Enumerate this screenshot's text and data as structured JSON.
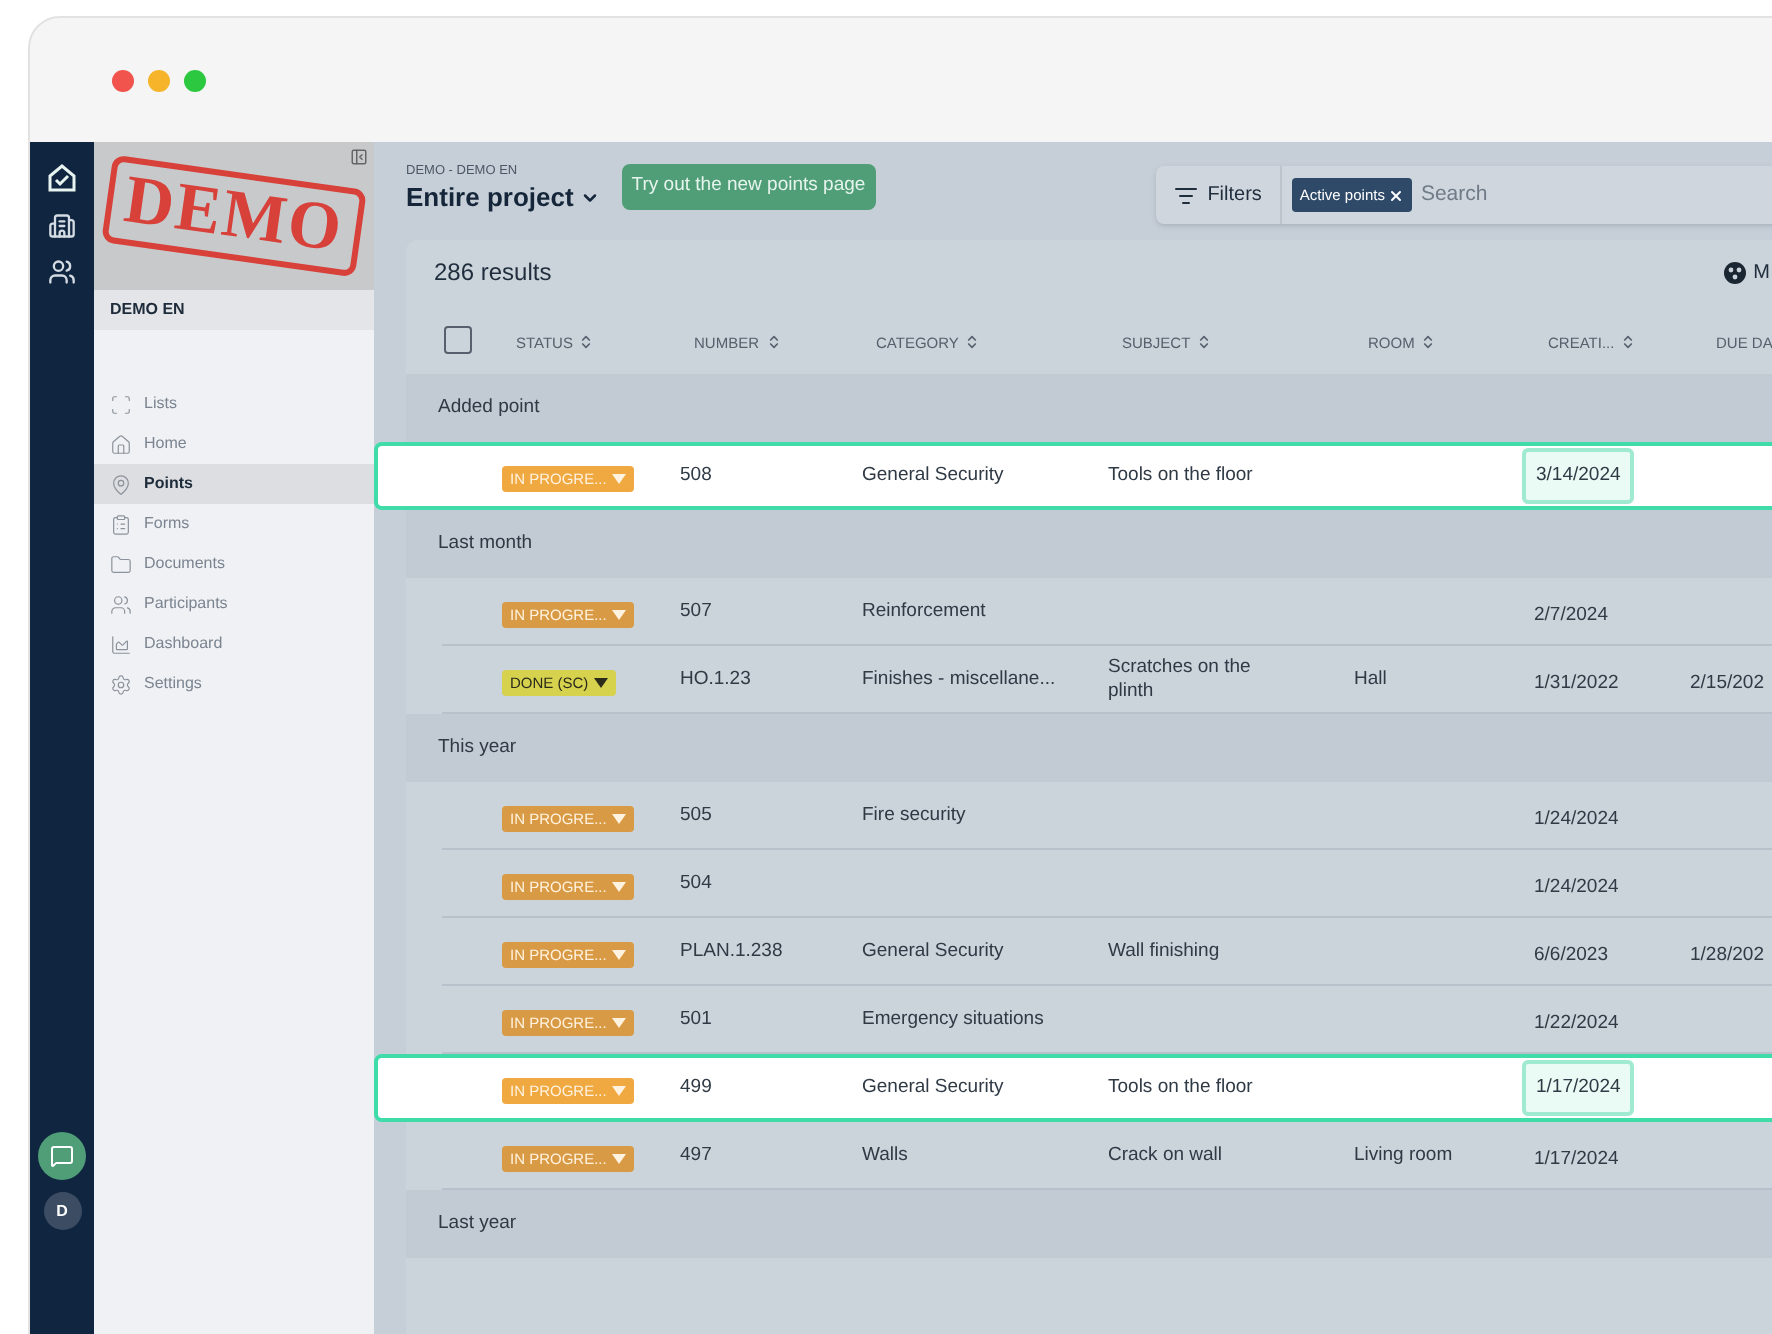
{
  "rail": {
    "avatar": "D"
  },
  "sidebar": {
    "stamp": "DEMO",
    "project": "DEMO EN",
    "items": [
      {
        "label": "Lists",
        "selected": false
      },
      {
        "label": "Home",
        "selected": false
      },
      {
        "label": "Points",
        "selected": true
      },
      {
        "label": "Forms",
        "selected": false
      },
      {
        "label": "Documents",
        "selected": false
      },
      {
        "label": "Participants",
        "selected": false
      },
      {
        "label": "Dashboard",
        "selected": false
      },
      {
        "label": "Settings",
        "selected": false
      }
    ]
  },
  "header": {
    "breadcrumb": "DEMO - DEMO EN",
    "title": "Entire project",
    "promo_button": "Try out the new points page"
  },
  "filters": {
    "button": "Filters",
    "chip": "Active points",
    "search": {
      "placeholder": "Search"
    }
  },
  "results": {
    "count": "286 results",
    "action": "M"
  },
  "table": {
    "columns": [
      "STATUS",
      "NUMBER",
      "CATEGORY",
      "SUBJECT",
      "ROOM",
      "CREATI...",
      "DUE DA"
    ],
    "groups": [
      {
        "label": "Added point",
        "rows": [
          {
            "status": {
              "label": "IN PROGRE...",
              "kind": "progress",
              "color": "#f0a840"
            },
            "number": "508",
            "category": "General Security",
            "subject": "Tools on the floor",
            "created": "3/14/2024",
            "highlighted": true
          }
        ]
      },
      {
        "label": "Last month",
        "rows": [
          {
            "status": {
              "label": "IN PROGRE...",
              "kind": "progress",
              "color": "#d99a45"
            },
            "number": "507",
            "category": "Reinforcement",
            "created": "2/7/2024",
            "highlighted": false
          },
          {
            "status": {
              "label": "DONE (SC)",
              "kind": "done",
              "color": "#d6d24e"
            },
            "number": "HO.1.23",
            "category": "Finishes - miscellane...",
            "subject": "Scratches on the plinth",
            "room": "Hall",
            "created": "1/31/2022",
            "due": "2/15/202",
            "highlighted": false
          }
        ]
      },
      {
        "label": "This year",
        "rows": [
          {
            "status": {
              "label": "IN PROGRE...",
              "kind": "progress",
              "color": "#d99a45"
            },
            "number": "505",
            "category": "Fire security",
            "created": "1/24/2024",
            "highlighted": false
          },
          {
            "status": {
              "label": "IN PROGRE...",
              "kind": "progress",
              "color": "#d99a45"
            },
            "number": "504",
            "created": "1/24/2024",
            "highlighted": false
          },
          {
            "status": {
              "label": "IN PROGRE...",
              "kind": "progress",
              "color": "#d99a45"
            },
            "number": "PLAN.1.238",
            "category": "General Security",
            "subject": "Wall finishing",
            "created": "6/6/2023",
            "due": "1/28/202",
            "highlighted": false
          },
          {
            "status": {
              "label": "IN PROGRE...",
              "kind": "progress",
              "color": "#d99a45"
            },
            "number": "501",
            "category": "Emergency situations",
            "created": "1/22/2024",
            "highlighted": false
          },
          {
            "status": {
              "label": "IN PROGRE...",
              "kind": "progress",
              "color": "#f0a840"
            },
            "number": "499",
            "category": "General Security",
            "subject": "Tools on the floor",
            "created": "1/17/2024",
            "highlighted": true
          },
          {
            "status": {
              "label": "IN PROGRE...",
              "kind": "progress",
              "color": "#d99a45"
            },
            "number": "497",
            "category": "Walls",
            "subject": "Crack on wall",
            "room": "Living room",
            "created": "1/17/2024",
            "highlighted": false
          }
        ]
      },
      {
        "label": "Last year"
      }
    ],
    "select_all": {
      "checked": false
    }
  }
}
